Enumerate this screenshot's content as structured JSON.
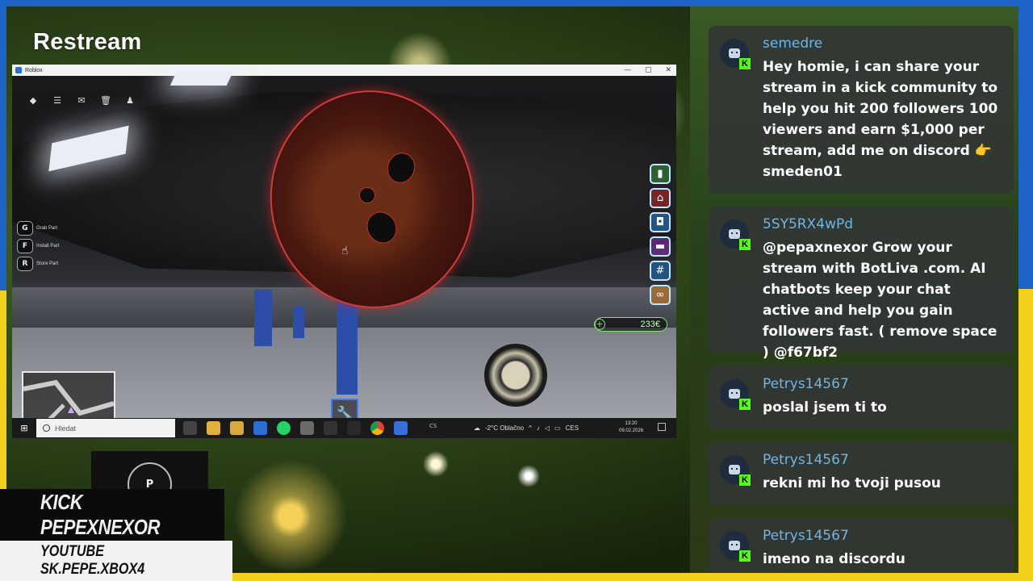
{
  "brand": {
    "name": "Restream"
  },
  "game_window": {
    "title": "Roblox",
    "controls": [
      "—",
      "▢",
      "✕"
    ],
    "key_hints": [
      {
        "key": "G",
        "label": "Grab Part"
      },
      {
        "key": "F",
        "label": "Install Part"
      },
      {
        "key": "R",
        "label": "Store Part"
      }
    ],
    "money": "233€",
    "side_buttons": [
      "inventory-icon",
      "shop-icon",
      "backpack-icon",
      "folder-icon",
      "hashtag-icon",
      "link-icon"
    ],
    "toolbar_icons": [
      "roblox-icon",
      "menu-icon",
      "chat-icon",
      "trash-icon",
      "people-icon"
    ]
  },
  "taskbar": {
    "search_placeholder": "Hledat",
    "cs_label": "CS",
    "weather": "-2°C  Oblačno",
    "lang": "CES",
    "time": "13:20",
    "date": "09.02.2026"
  },
  "overlay": {
    "avatar_initial": "P",
    "kick_handle": "KICK PEPEXNEXOR",
    "youtube_handle": "YOUTUBE SK.PEPE.XBOX4"
  },
  "chat": {
    "messages": [
      {
        "user": "semedre",
        "text": "Hey homie, i can share your stream in a kick community to help you hit 200 followers 100 viewers and earn $1,000 per stream, add me on discord 👉 smeden01"
      },
      {
        "user": "5SY5RX4wPd",
        "text": "@pepaxnexor Grow your stream with BotLiva .com. AI chatbots keep your chat active and help you gain followers fast. ( remove space ) @f67bf2"
      },
      {
        "user": "Petrys14567",
        "text": "poslal jsem ti to"
      },
      {
        "user": "Petrys14567",
        "text": "rekni mi ho tvoji pusou"
      },
      {
        "user": "Petrys14567",
        "text": "imeno na discordu"
      }
    ]
  },
  "colors": {
    "accent_blue": "#1e63c8",
    "accent_yellow": "#f2d01b",
    "username": "#6fb6e6",
    "kick_green": "#53fc18"
  }
}
